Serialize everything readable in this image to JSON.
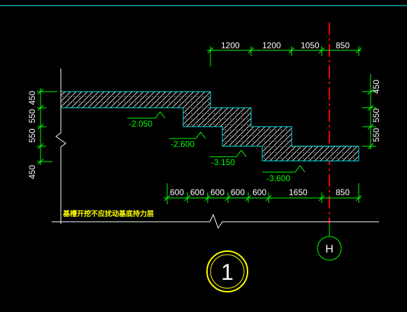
{
  "colors": {
    "background": "#000000",
    "dimension": "#00ff00",
    "dimension_text": "#ffffff",
    "concrete": "#00e5e5",
    "level_text": "#00ff00",
    "axis_line": "#ff0000",
    "grid_bubble": "#00ff00",
    "note_text": "#ffff00",
    "title_circle": "#ffff00",
    "frame_line": "#00ffff"
  },
  "top_dimensions": [
    "1200",
    "1200",
    "1050",
    "850"
  ],
  "bottom_dimensions": [
    "600",
    "600",
    "600",
    "600",
    "600",
    "1650",
    "850"
  ],
  "left_dimensions": [
    "450",
    "550",
    "550",
    "450"
  ],
  "right_dimensions": [
    "450",
    "550",
    "550"
  ],
  "levels": [
    "-2.050",
    "-2.600",
    "-3.150",
    "-3.600"
  ],
  "note": "基槽开挖不应扰动基底持力层",
  "grid_axis": "H",
  "detail_number": "1"
}
